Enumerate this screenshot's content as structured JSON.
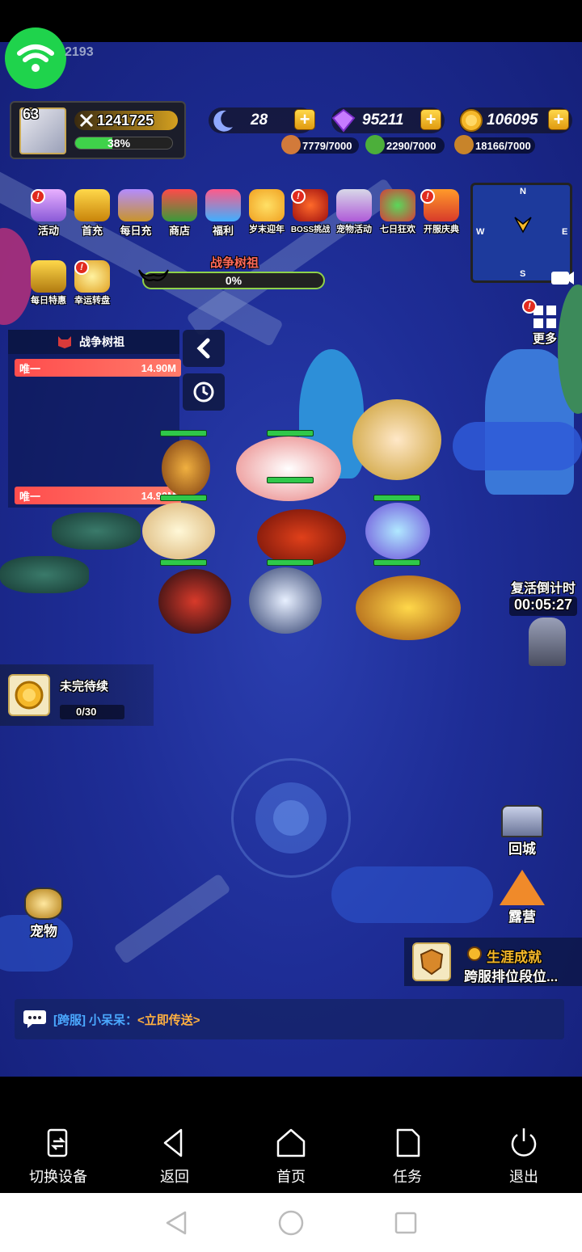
{
  "status": {
    "id_fragment": "2193"
  },
  "player": {
    "level": "63",
    "power": "1241725",
    "exp_percent_text": "38%",
    "exp_fraction": 0.38
  },
  "currencies": [
    {
      "name": "moon-crystal",
      "value": "28"
    },
    {
      "name": "diamond",
      "value": "95211"
    },
    {
      "name": "gold",
      "value": "106095"
    }
  ],
  "sub_resources": [
    {
      "name": "meat",
      "value": "7779/7000"
    },
    {
      "name": "herb",
      "value": "2290/7000"
    },
    {
      "name": "wood",
      "value": "18166/7000"
    }
  ],
  "menu": {
    "activities": "活动",
    "first_recharge": "首充",
    "daily_recharge": "每日充",
    "shop": "商店",
    "welfare": "福利",
    "year_end": "岁末迎年",
    "boss_challenge": "BOSS挑战",
    "pet_event": "宠物活动",
    "seven_day": "七日狂欢",
    "server_celebration": "开服庆典",
    "daily_deal": "每日特惠",
    "lucky_wheel": "幸运转盘",
    "more": "更多"
  },
  "badge_mark": "!",
  "minimap": {
    "n": "N",
    "s": "S",
    "e": "E",
    "w": "W"
  },
  "war": {
    "title": "战争树祖",
    "progress_text": "0%",
    "progress": 0.0
  },
  "boss_panel": {
    "title": "战争树祖",
    "rows": [
      {
        "rank": "唯一",
        "damage": "14.90M"
      },
      {
        "rank": "唯一",
        "damage": "14.90M"
      }
    ]
  },
  "revive": {
    "label": "复活倒计时",
    "time": "00:05:27"
  },
  "quest": {
    "title": "未完待续",
    "progress": "0/30"
  },
  "side": {
    "return_city": "回城",
    "camp": "露营",
    "pet": "宠物"
  },
  "achievement": {
    "title": "生涯成就",
    "subtitle": "跨服排位段位..."
  },
  "chat": {
    "channel": "[跨服]",
    "sender": "小呆呆：",
    "message": "<立即传送>"
  },
  "navbar": {
    "switch_device": "切换设备",
    "back": "返回",
    "home": "首页",
    "tasks": "任务",
    "exit": "退出"
  },
  "colors": {
    "accent_gold": "#f5b82a",
    "hp_green": "#2fc84a",
    "boss_red": "#ff4d4d",
    "chat_blue": "#4aa8ff",
    "chat_orange": "#ffb040"
  }
}
